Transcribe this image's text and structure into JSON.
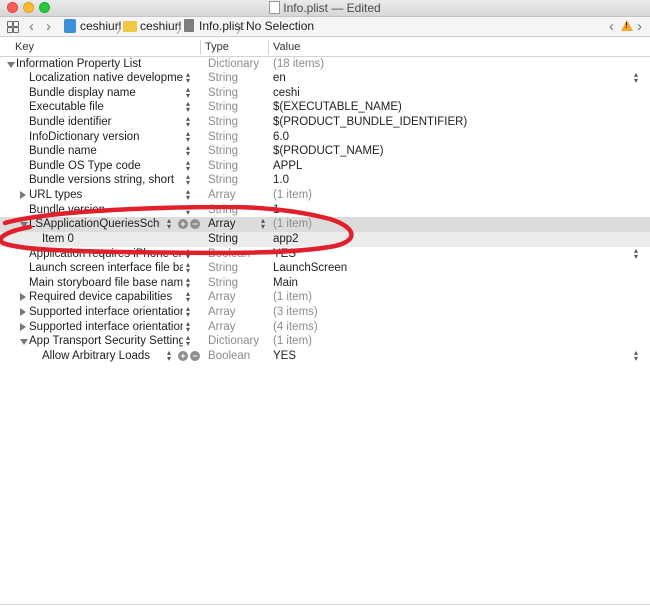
{
  "window": {
    "title": "Info.plist — Edited"
  },
  "jumpbar": {
    "items": [
      "ceshiurl",
      "ceshiurl",
      "Info.plist",
      "No Selection"
    ]
  },
  "columns": [
    "Key",
    "Type",
    "Value"
  ],
  "rows": [
    {
      "key": "Information Property List",
      "type": "Dictionary",
      "value": "(18 items)",
      "disclosure": "down",
      "level": 0,
      "stepper": false
    },
    {
      "key": "Localization native development re...",
      "type": "String",
      "value": "en",
      "level": 1,
      "stepper": true,
      "value_stepper": true
    },
    {
      "key": "Bundle display name",
      "type": "String",
      "value": "ceshi",
      "level": 1,
      "stepper": true
    },
    {
      "key": "Executable file",
      "type": "String",
      "value": "$(EXECUTABLE_NAME)",
      "level": 1,
      "stepper": true
    },
    {
      "key": "Bundle identifier",
      "type": "String",
      "value": "$(PRODUCT_BUNDLE_IDENTIFIER)",
      "level": 1,
      "stepper": true
    },
    {
      "key": "InfoDictionary version",
      "type": "String",
      "value": "6.0",
      "level": 1,
      "stepper": true
    },
    {
      "key": "Bundle name",
      "type": "String",
      "value": "$(PRODUCT_NAME)",
      "level": 1,
      "stepper": true
    },
    {
      "key": "Bundle OS Type code",
      "type": "String",
      "value": "APPL",
      "level": 1,
      "stepper": true
    },
    {
      "key": "Bundle versions string, short",
      "type": "String",
      "value": "1.0",
      "level": 1,
      "stepper": true
    },
    {
      "key": "URL types",
      "type": "Array",
      "value": "(1 item)",
      "disclosure": "right",
      "level": 1,
      "stepper": true
    },
    {
      "key": "Bundle version",
      "type": "String",
      "value": "1",
      "level": 1,
      "stepper": true
    },
    {
      "key": "LSApplicationQueriesSchemes",
      "type": "Array",
      "value": "(1 item)",
      "disclosure": "down",
      "level": 1,
      "stepper": true,
      "selected": true,
      "buttons": true
    },
    {
      "key": "Item 0",
      "type": "String",
      "value": "app2",
      "level": 2,
      "stepper": false,
      "sub": true
    },
    {
      "key": "Application requires iPhone enviro...",
      "type": "Boolean",
      "value": "YES",
      "level": 1,
      "stepper": true,
      "value_stepper": true
    },
    {
      "key": "Launch screen interface file base...",
      "type": "String",
      "value": "LaunchScreen",
      "level": 1,
      "stepper": true
    },
    {
      "key": "Main storyboard file base name",
      "type": "String",
      "value": "Main",
      "level": 1,
      "stepper": true
    },
    {
      "key": "Required device capabilities",
      "type": "Array",
      "value": "(1 item)",
      "disclosure": "right",
      "level": 1,
      "stepper": true
    },
    {
      "key": "Supported interface orientations",
      "type": "Array",
      "value": "(3 items)",
      "disclosure": "right",
      "level": 1,
      "stepper": true
    },
    {
      "key": "Supported interface orientations (i...",
      "type": "Array",
      "value": "(4 items)",
      "disclosure": "right",
      "level": 1,
      "stepper": true
    },
    {
      "key": "App Transport Security Settings",
      "type": "Dictionary",
      "value": "(1 item)",
      "disclosure": "down",
      "level": 1,
      "stepper": true
    },
    {
      "key": "Allow Arbitrary Loads",
      "type": "Boolean",
      "value": "YES",
      "level": 2,
      "stepper": true,
      "buttons": true,
      "value_stepper": true
    }
  ],
  "colors": {
    "annotation_red": "#e0212d",
    "warning": "#f5a623"
  }
}
